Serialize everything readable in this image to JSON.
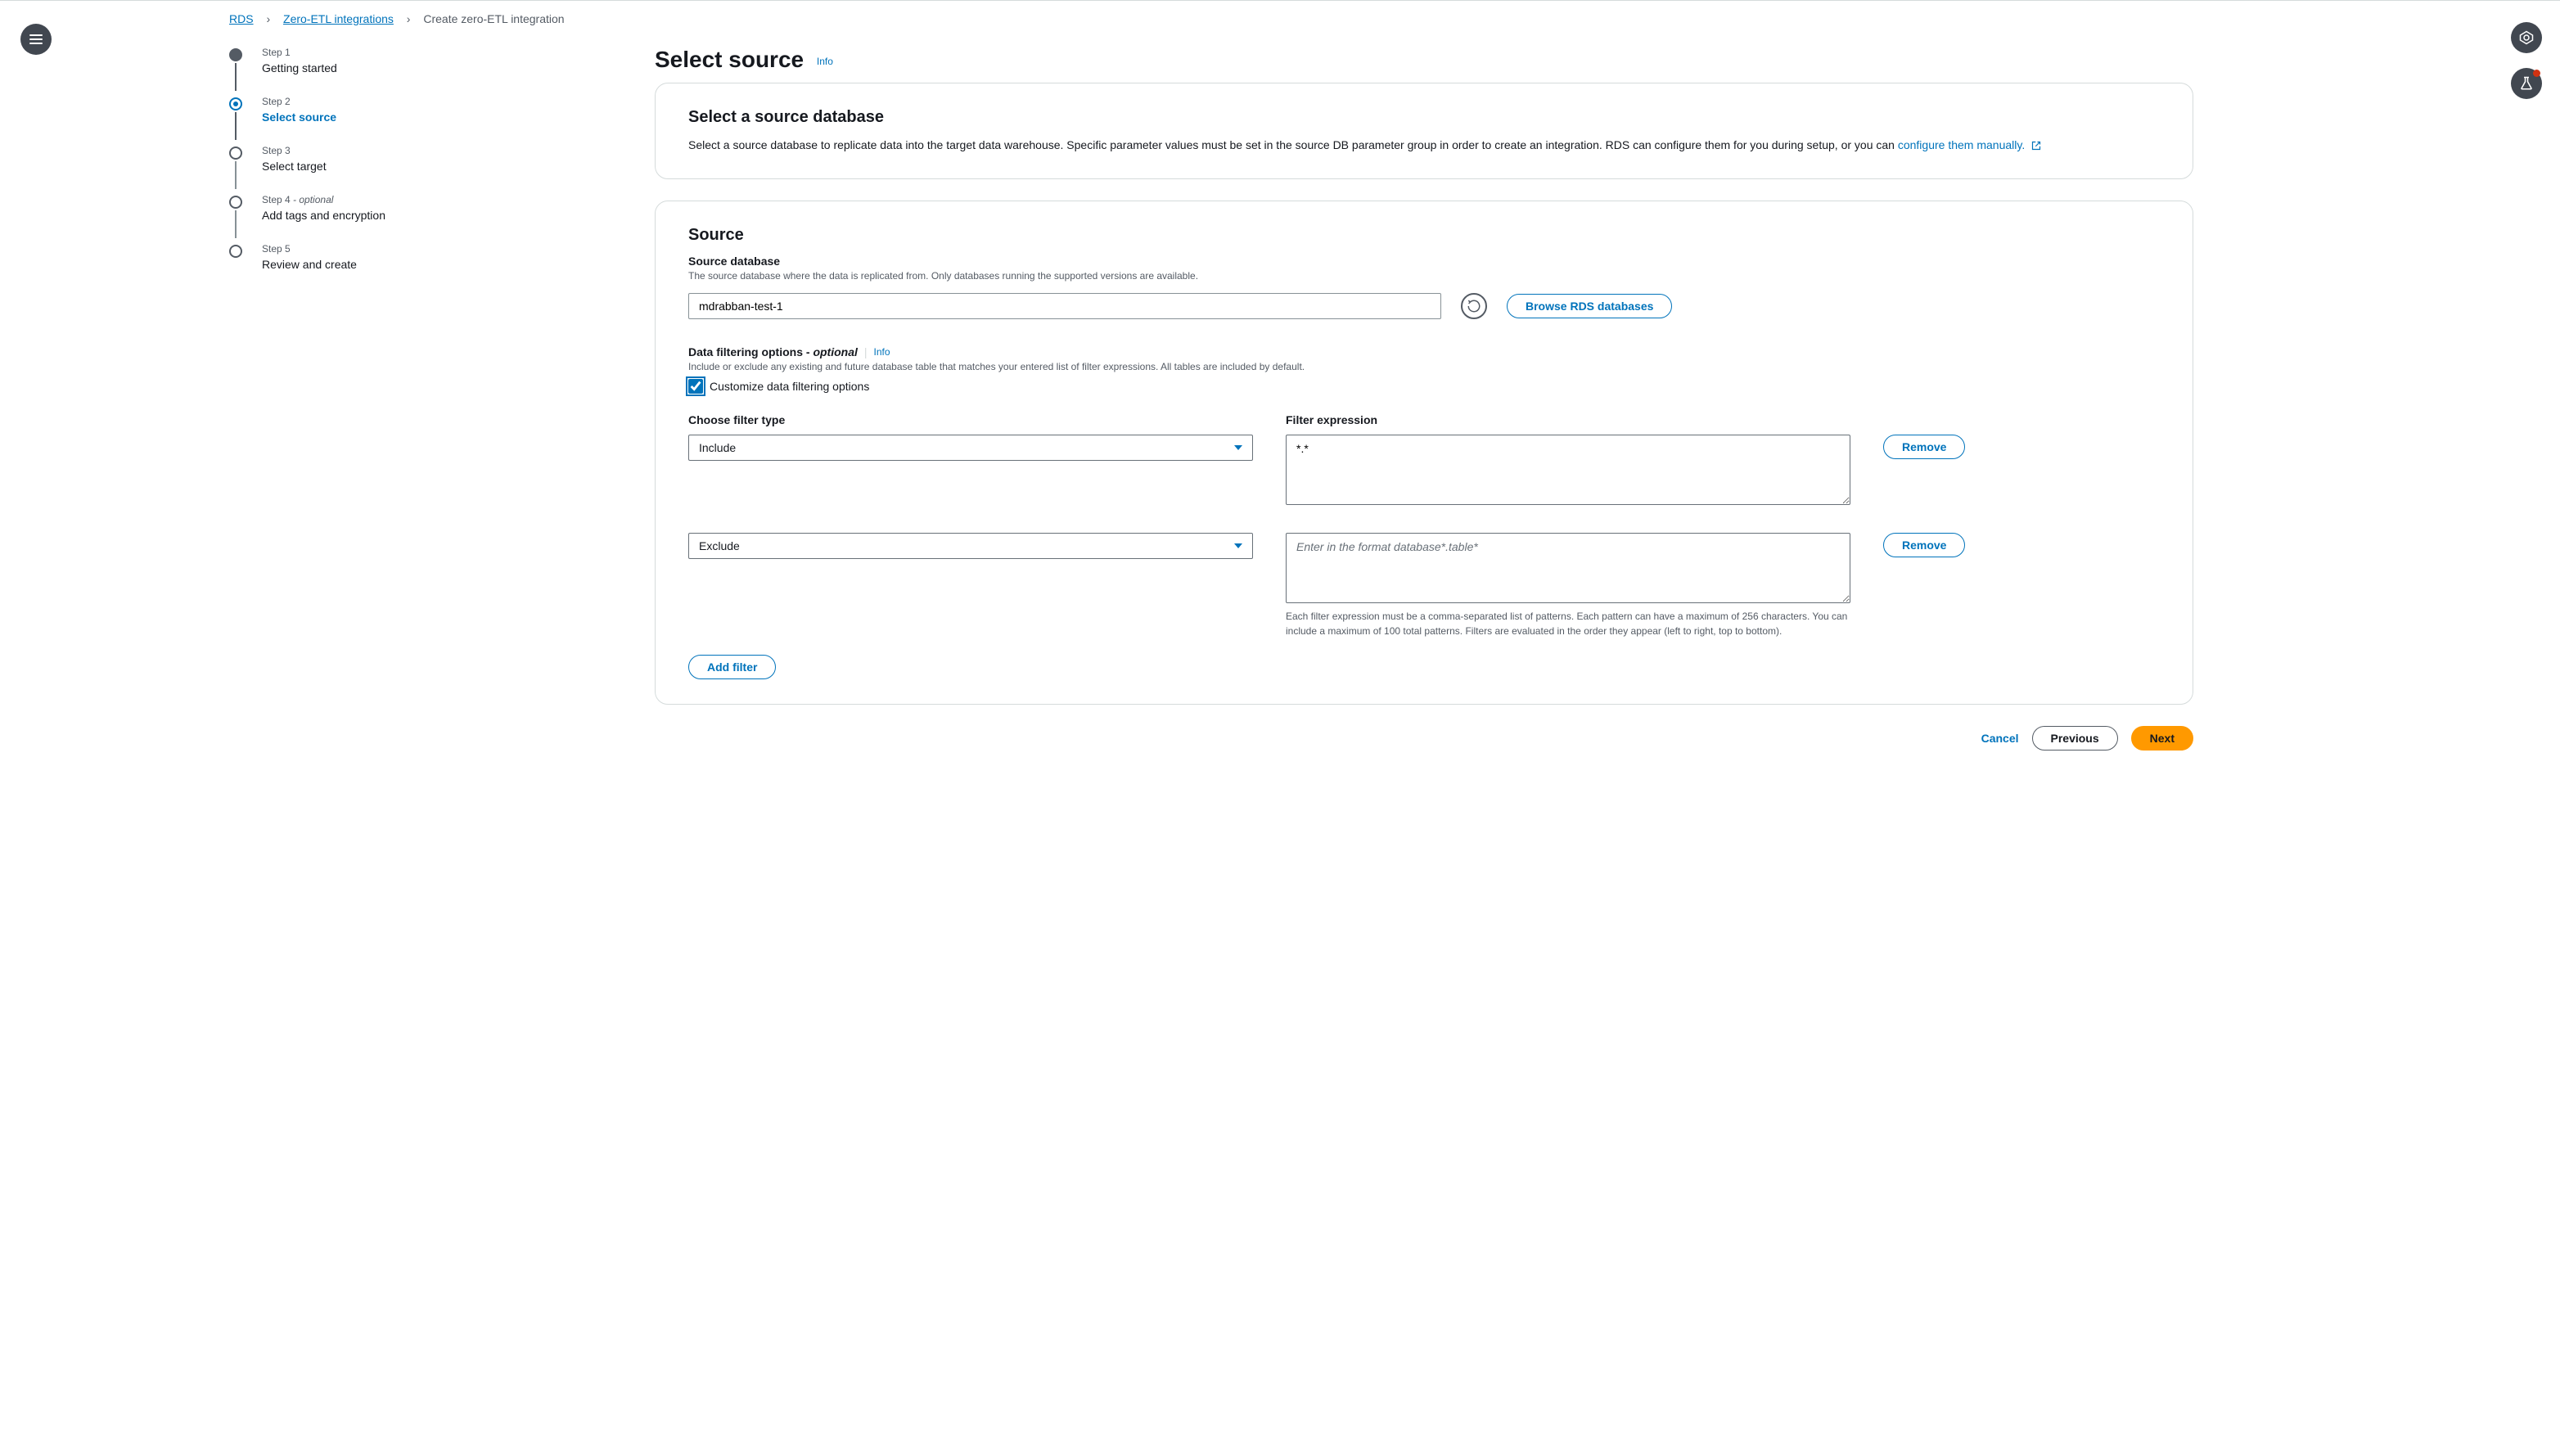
{
  "breadcrumb": {
    "items": [
      {
        "label": "RDS",
        "link": true
      },
      {
        "label": "Zero-ETL integrations",
        "link": true
      },
      {
        "label": "Create zero-ETL integration",
        "link": false
      }
    ]
  },
  "wizard": {
    "steps": [
      {
        "step": "Step 1",
        "name": "Getting started",
        "state": "done"
      },
      {
        "step": "Step 2",
        "name": "Select source",
        "state": "current"
      },
      {
        "step": "Step 3",
        "name": "Select target",
        "state": "todo"
      },
      {
        "step": "Step 4",
        "suffix": " - optional",
        "name": "Add tags and encryption",
        "state": "todo"
      },
      {
        "step": "Step 5",
        "name": "Review and create",
        "state": "todo"
      }
    ]
  },
  "page": {
    "title": "Select source",
    "info_link": "Info"
  },
  "intro": {
    "heading": "Select a source database",
    "body_1": "Select a source database to replicate data into the target data warehouse. Specific parameter values must be set in the source DB parameter group in order to create an integration. RDS can configure them for you during setup, or you can ",
    "config_link": "configure them manually."
  },
  "source": {
    "heading": "Source",
    "db_label": "Source database",
    "db_help": "The source database where the data is replicated from. Only databases running the supported versions are available.",
    "db_value": "mdrabban-test-1",
    "browse_btn": "Browse RDS databases",
    "filter_title_main": "Data filtering options - ",
    "filter_title_opt": "optional",
    "filter_info": "Info",
    "filter_help": "Include or exclude any existing and future database table that matches your entered list of filter expressions. All tables are included by default.",
    "customize_label": "Customize data filtering options",
    "col_type": "Choose filter type",
    "col_expr": "Filter expression",
    "filters": [
      {
        "type": "Include",
        "expr": "*.*"
      },
      {
        "type": "Exclude",
        "expr": ""
      }
    ],
    "expr_placeholder": "Enter in the format database*.table*",
    "remove_btn": "Remove",
    "expr_note": "Each filter expression must be a comma-separated list of patterns. Each pattern can have a maximum of 256 characters. You can include a maximum of 100 total patterns. Filters are evaluated in the order they appear (left to right, top to bottom).",
    "add_filter_btn": "Add filter"
  },
  "footer": {
    "cancel": "Cancel",
    "previous": "Previous",
    "next": "Next"
  }
}
